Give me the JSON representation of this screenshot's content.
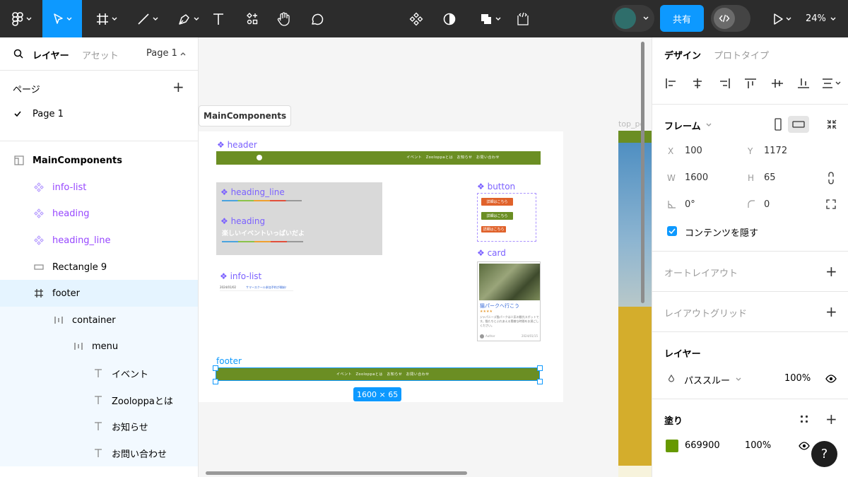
{
  "toolbar": {
    "share_label": "共有",
    "zoom": "24%"
  },
  "left_panel": {
    "tabs": {
      "layers": "レイヤー",
      "assets": "アセット",
      "page_selector": "Page 1"
    },
    "pages_title": "ページ",
    "pages": [
      {
        "label": "Page 1"
      }
    ],
    "layers": [
      {
        "label": "MainComponents"
      },
      {
        "label": "info-list"
      },
      {
        "label": "heading"
      },
      {
        "label": "heading_line"
      },
      {
        "label": "Rectangle 9"
      },
      {
        "label": "footer"
      },
      {
        "label": "container"
      },
      {
        "label": "menu"
      },
      {
        "label": "イベント"
      },
      {
        "label": "Zooloppaとは"
      },
      {
        "label": "お知らせ"
      },
      {
        "label": "お問い合わせ"
      }
    ]
  },
  "canvas": {
    "frame_label": "MainComponents",
    "right_frame_label": "top_pc",
    "components": {
      "header": "header",
      "heading_line": "heading_line",
      "heading": "heading",
      "heading_text": "楽しいイベントいっぱいだよ",
      "button": "button",
      "card": "card",
      "info_list": "info-list",
      "footer": "footer"
    },
    "header_nav": "イベント　Zooloppaとは　お知らせ　お問い合わせ",
    "footer_nav": "イベント　Zooloppaとは　お知らせ　お問い合わせ",
    "buttons": [
      "詳細はこちら",
      "詳細はこちら",
      "詳細はこちら"
    ],
    "card": {
      "title": "猫パークへ行こう",
      "stars": "★★★★",
      "text": "ジャパニーズ猫パークは人気の観光スポットです。猫たちとふれあえる素敵な時間をお過ごしください。",
      "author": "Author",
      "date": "2024/01/15"
    },
    "info_item": {
      "date": "2024/01/02",
      "text": "サマースクール参加予約が開始！"
    },
    "size_badge": "1600 × 65"
  },
  "right_panel": {
    "tabs": {
      "design": "デザイン",
      "prototype": "プロトタイプ"
    },
    "frame": {
      "title": "フレーム",
      "x_label": "X",
      "x": "100",
      "y_label": "Y",
      "y": "1172",
      "w_label": "W",
      "w": "1600",
      "h_label": "H",
      "h": "65",
      "rotation": "0°",
      "radius": "0",
      "clip_label": "コンテンツを隠す"
    },
    "auto_layout": "オートレイアウト",
    "layout_grid": "レイアウトグリッド",
    "layer": {
      "title": "レイヤー",
      "blend": "パススルー",
      "opacity": "100%"
    },
    "fill": {
      "title": "塗り",
      "color": "#669900",
      "hex": "669900",
      "opacity": "100%"
    }
  }
}
